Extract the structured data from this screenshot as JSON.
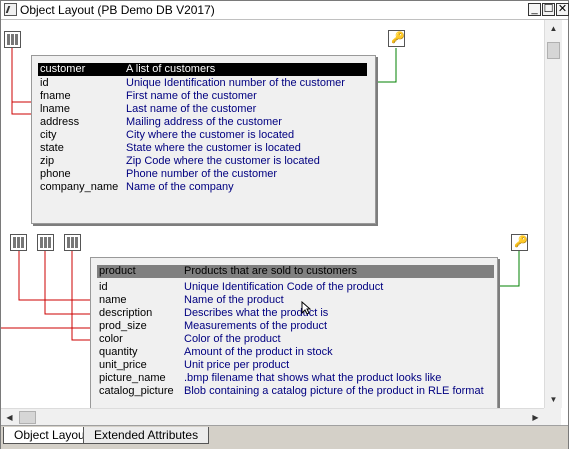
{
  "window": {
    "title": "Object Layout (PB Demo DB V2017)",
    "buttons": {
      "minimize": "_",
      "maximize": "☐",
      "close": "✕"
    }
  },
  "tabs": [
    {
      "label": "Object Layout",
      "active": true
    },
    {
      "label": "Extended Attributes",
      "active": false
    }
  ],
  "tables": {
    "customer": {
      "name": "customer",
      "comment": "A list of customers",
      "header_bg": "#000000",
      "header_fg": "#ffffff",
      "columns": [
        {
          "name": "id",
          "desc": "Unique Identification number of the customer"
        },
        {
          "name": "fname",
          "desc": "First name of the customer"
        },
        {
          "name": "lname",
          "desc": "Last name of the customer"
        },
        {
          "name": "address",
          "desc": "Mailing address of the customer"
        },
        {
          "name": "city",
          "desc": "City where the customer is located"
        },
        {
          "name": "state",
          "desc": "State where the customer is located"
        },
        {
          "name": "zip",
          "desc": "Zip Code where the customer is located"
        },
        {
          "name": "phone",
          "desc": "Phone number of the customer"
        },
        {
          "name": "company_name",
          "desc": "Name of the company"
        }
      ]
    },
    "product": {
      "name": "product",
      "comment": "Products that are sold to customers",
      "header_bg": "#808080",
      "header_fg": "#000000",
      "columns": [
        {
          "name": "id",
          "desc": "Unique Identification Code of the product"
        },
        {
          "name": "name",
          "desc": "Name of the product"
        },
        {
          "name": "description",
          "desc": "Describes what the product is"
        },
        {
          "name": "prod_size",
          "desc": "Measurements of the product"
        },
        {
          "name": "color",
          "desc": "Color of the product"
        },
        {
          "name": "quantity",
          "desc": "Amount of the product in stock"
        },
        {
          "name": "unit_price",
          "desc": "Unit price per product"
        },
        {
          "name": "picture_name",
          "desc": ".bmp filename that shows what the product looks like"
        },
        {
          "name": "catalog_picture",
          "desc": "Blob containing a catalog picture of the product in RLE format"
        }
      ]
    }
  },
  "icons": {
    "index_badge": "index-icon",
    "primary_key": "primary-key-icon"
  },
  "colors": {
    "index_link": "#cc0000",
    "key_link": "#008000",
    "column_desc": "#000080"
  }
}
